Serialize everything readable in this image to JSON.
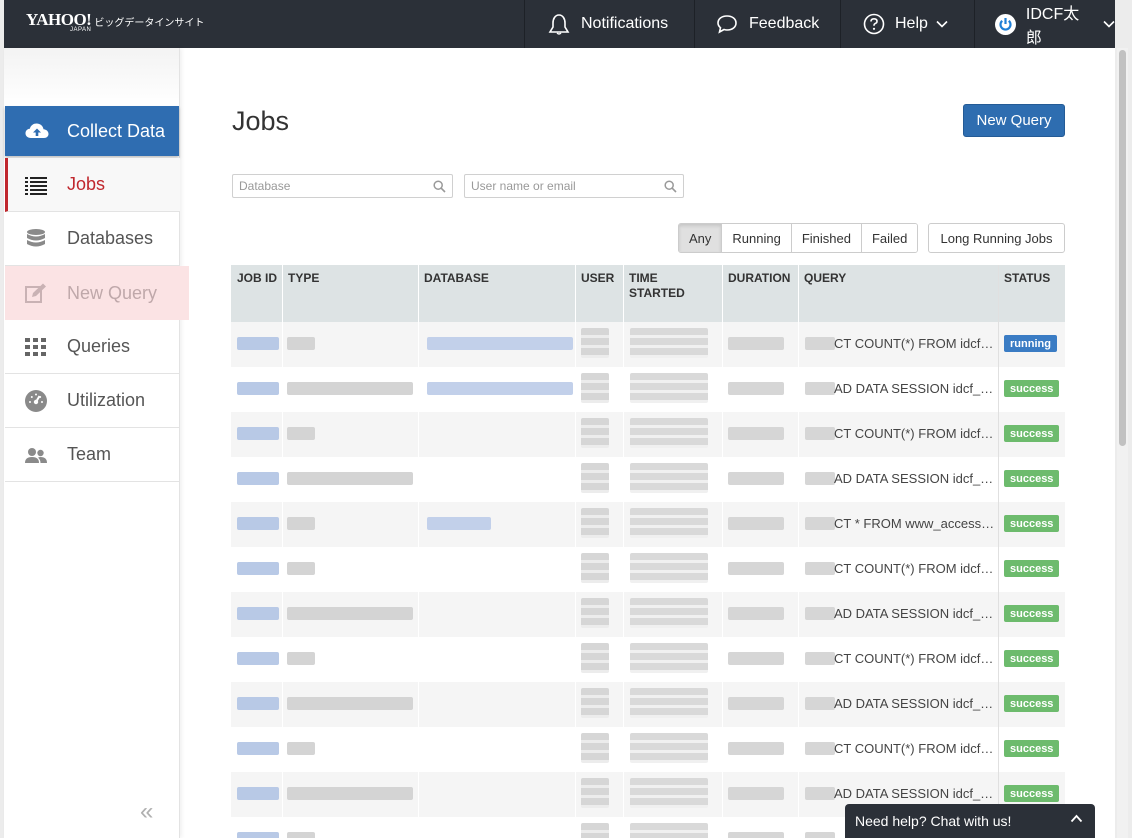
{
  "brand": {
    "logo": "YAHOO!",
    "japan": "JAPAN",
    "subtitle": "ビッグデータインサイト"
  },
  "nav": {
    "notifications": "Notifications",
    "feedback": "Feedback",
    "help": "Help",
    "user": "IDCF太郎"
  },
  "sidebar": {
    "collect": "Collect Data",
    "items": [
      {
        "label": "Jobs"
      },
      {
        "label": "Databases"
      },
      {
        "label": "New Query"
      },
      {
        "label": "Queries"
      },
      {
        "label": "Utilization"
      },
      {
        "label": "Team"
      }
    ],
    "collapse": "«"
  },
  "main": {
    "title": "Jobs",
    "new_query_button": "New Query",
    "search_db_placeholder": "Database",
    "search_user_placeholder": "User name or email",
    "filters": [
      "Any",
      "Running",
      "Finished",
      "Failed"
    ],
    "active_filter": "Any",
    "long_running_button": "Long Running Jobs"
  },
  "table": {
    "columns": {
      "job_id": "JOB ID",
      "type": "TYPE",
      "database": "DATABASE",
      "user": "USER",
      "time_started_1": "TIME",
      "time_started_2": "STARTED",
      "duration": "DURATION",
      "query": "QUERY",
      "status": "STATUS"
    },
    "rows": [
      {
        "query": "CT COUNT(*) FROM idcf…",
        "status": "running"
      },
      {
        "query": "AD DATA SESSION idcf_…",
        "status": "success"
      },
      {
        "query": "CT COUNT(*) FROM idcf…",
        "status": "success"
      },
      {
        "query": "AD DATA SESSION idcf_…",
        "status": "success"
      },
      {
        "query": "CT * FROM www_access…",
        "status": "success"
      },
      {
        "query": "CT COUNT(*) FROM idcf…",
        "status": "success"
      },
      {
        "query": "AD DATA SESSION idcf_…",
        "status": "success"
      },
      {
        "query": "CT COUNT(*) FROM idcf…",
        "status": "success"
      },
      {
        "query": "AD DATA SESSION idcf_…",
        "status": "success"
      },
      {
        "query": "CT COUNT(*) FROM idcf…",
        "status": "success"
      },
      {
        "query": "AD DATA SESSION idcf_…",
        "status": "success"
      },
      {
        "query": "",
        "status": ""
      }
    ]
  },
  "chat": {
    "label": "Need help? Chat with us!"
  },
  "colors": {
    "accent": "#2e6db0",
    "active": "#c0272d",
    "running": "#3a7cc4",
    "success": "#6dbb6d",
    "topbar": "#2b3038"
  }
}
